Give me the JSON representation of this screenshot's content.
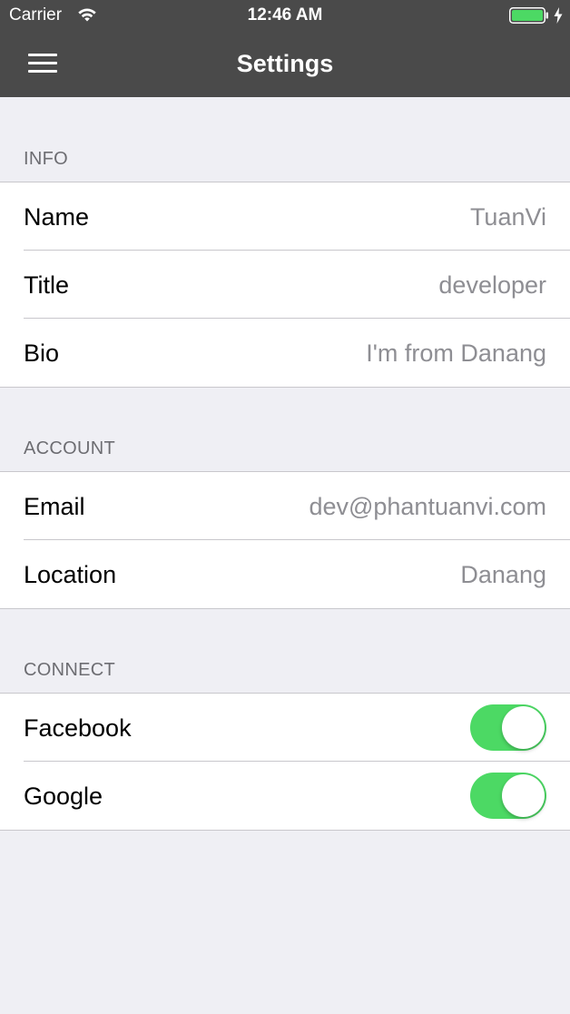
{
  "status_bar": {
    "carrier": "Carrier",
    "time": "12:46 AM",
    "wifi_icon": "wifi-icon",
    "battery_icon": "battery-icon",
    "battery_level": 1.0,
    "charging_icon": "charging-bolt-icon"
  },
  "nav_bar": {
    "menu_icon": "hamburger-menu-icon",
    "title": "Settings"
  },
  "sections": {
    "info": {
      "header": "INFO",
      "rows": [
        {
          "label": "Name",
          "value": "TuanVi"
        },
        {
          "label": "Title",
          "value": "developer"
        },
        {
          "label": "Bio",
          "value": "I'm from Danang"
        }
      ]
    },
    "account": {
      "header": "ACCOUNT",
      "rows": [
        {
          "label": "Email",
          "value": "dev@phantuanvi.com"
        },
        {
          "label": "Location",
          "value": "Danang"
        }
      ]
    },
    "connect": {
      "header": "CONNECT",
      "rows": [
        {
          "label": "Facebook",
          "enabled": true
        },
        {
          "label": "Google",
          "enabled": true
        }
      ]
    }
  },
  "colors": {
    "nav_background": "#4a4a4a",
    "page_background": "#efeff4",
    "toggle_on": "#4cd964",
    "battery_fill": "#4cd964",
    "value_text": "#8e8e93",
    "header_text": "#6d6d72"
  }
}
